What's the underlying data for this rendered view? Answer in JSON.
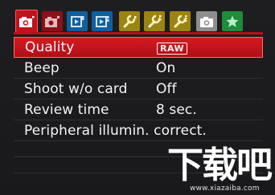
{
  "tabs": [
    {
      "icon": "camera-icon",
      "color": "#c2121c",
      "active": true
    },
    {
      "icon": "camera-icon",
      "color": "#8a1118",
      "active": false
    },
    {
      "icon": "playback-icon",
      "color": "#0f5f9e",
      "active": false
    },
    {
      "icon": "playback-icon",
      "color": "#0f5f9e",
      "active": false
    },
    {
      "icon": "wrench-icon",
      "color": "#9c8412",
      "active": false
    },
    {
      "icon": "wrench-icon",
      "color": "#9c8412",
      "active": false
    },
    {
      "icon": "wrench-icon",
      "color": "#9c8412",
      "active": false
    },
    {
      "icon": "camera-icon",
      "color": "#8e8e8e",
      "active": false
    },
    {
      "icon": "star-icon",
      "color": "#1e8c3a",
      "active": false
    }
  ],
  "menu": {
    "items": [
      {
        "label": "Quality",
        "value": "RAW",
        "selected": true
      },
      {
        "label": "Beep",
        "value": "On"
      },
      {
        "label": "Shoot w/o card",
        "value": "Off"
      },
      {
        "label": "Review time",
        "value": "8 sec."
      },
      {
        "label": "Peripheral illumin. correct.",
        "value": ""
      }
    ]
  },
  "watermark": {
    "text": "下载吧",
    "url": "www.xiazaiba.com"
  },
  "colors": {
    "accent": "#c2121c",
    "background": "#1c1c1e",
    "text": "#f4f4f4"
  }
}
